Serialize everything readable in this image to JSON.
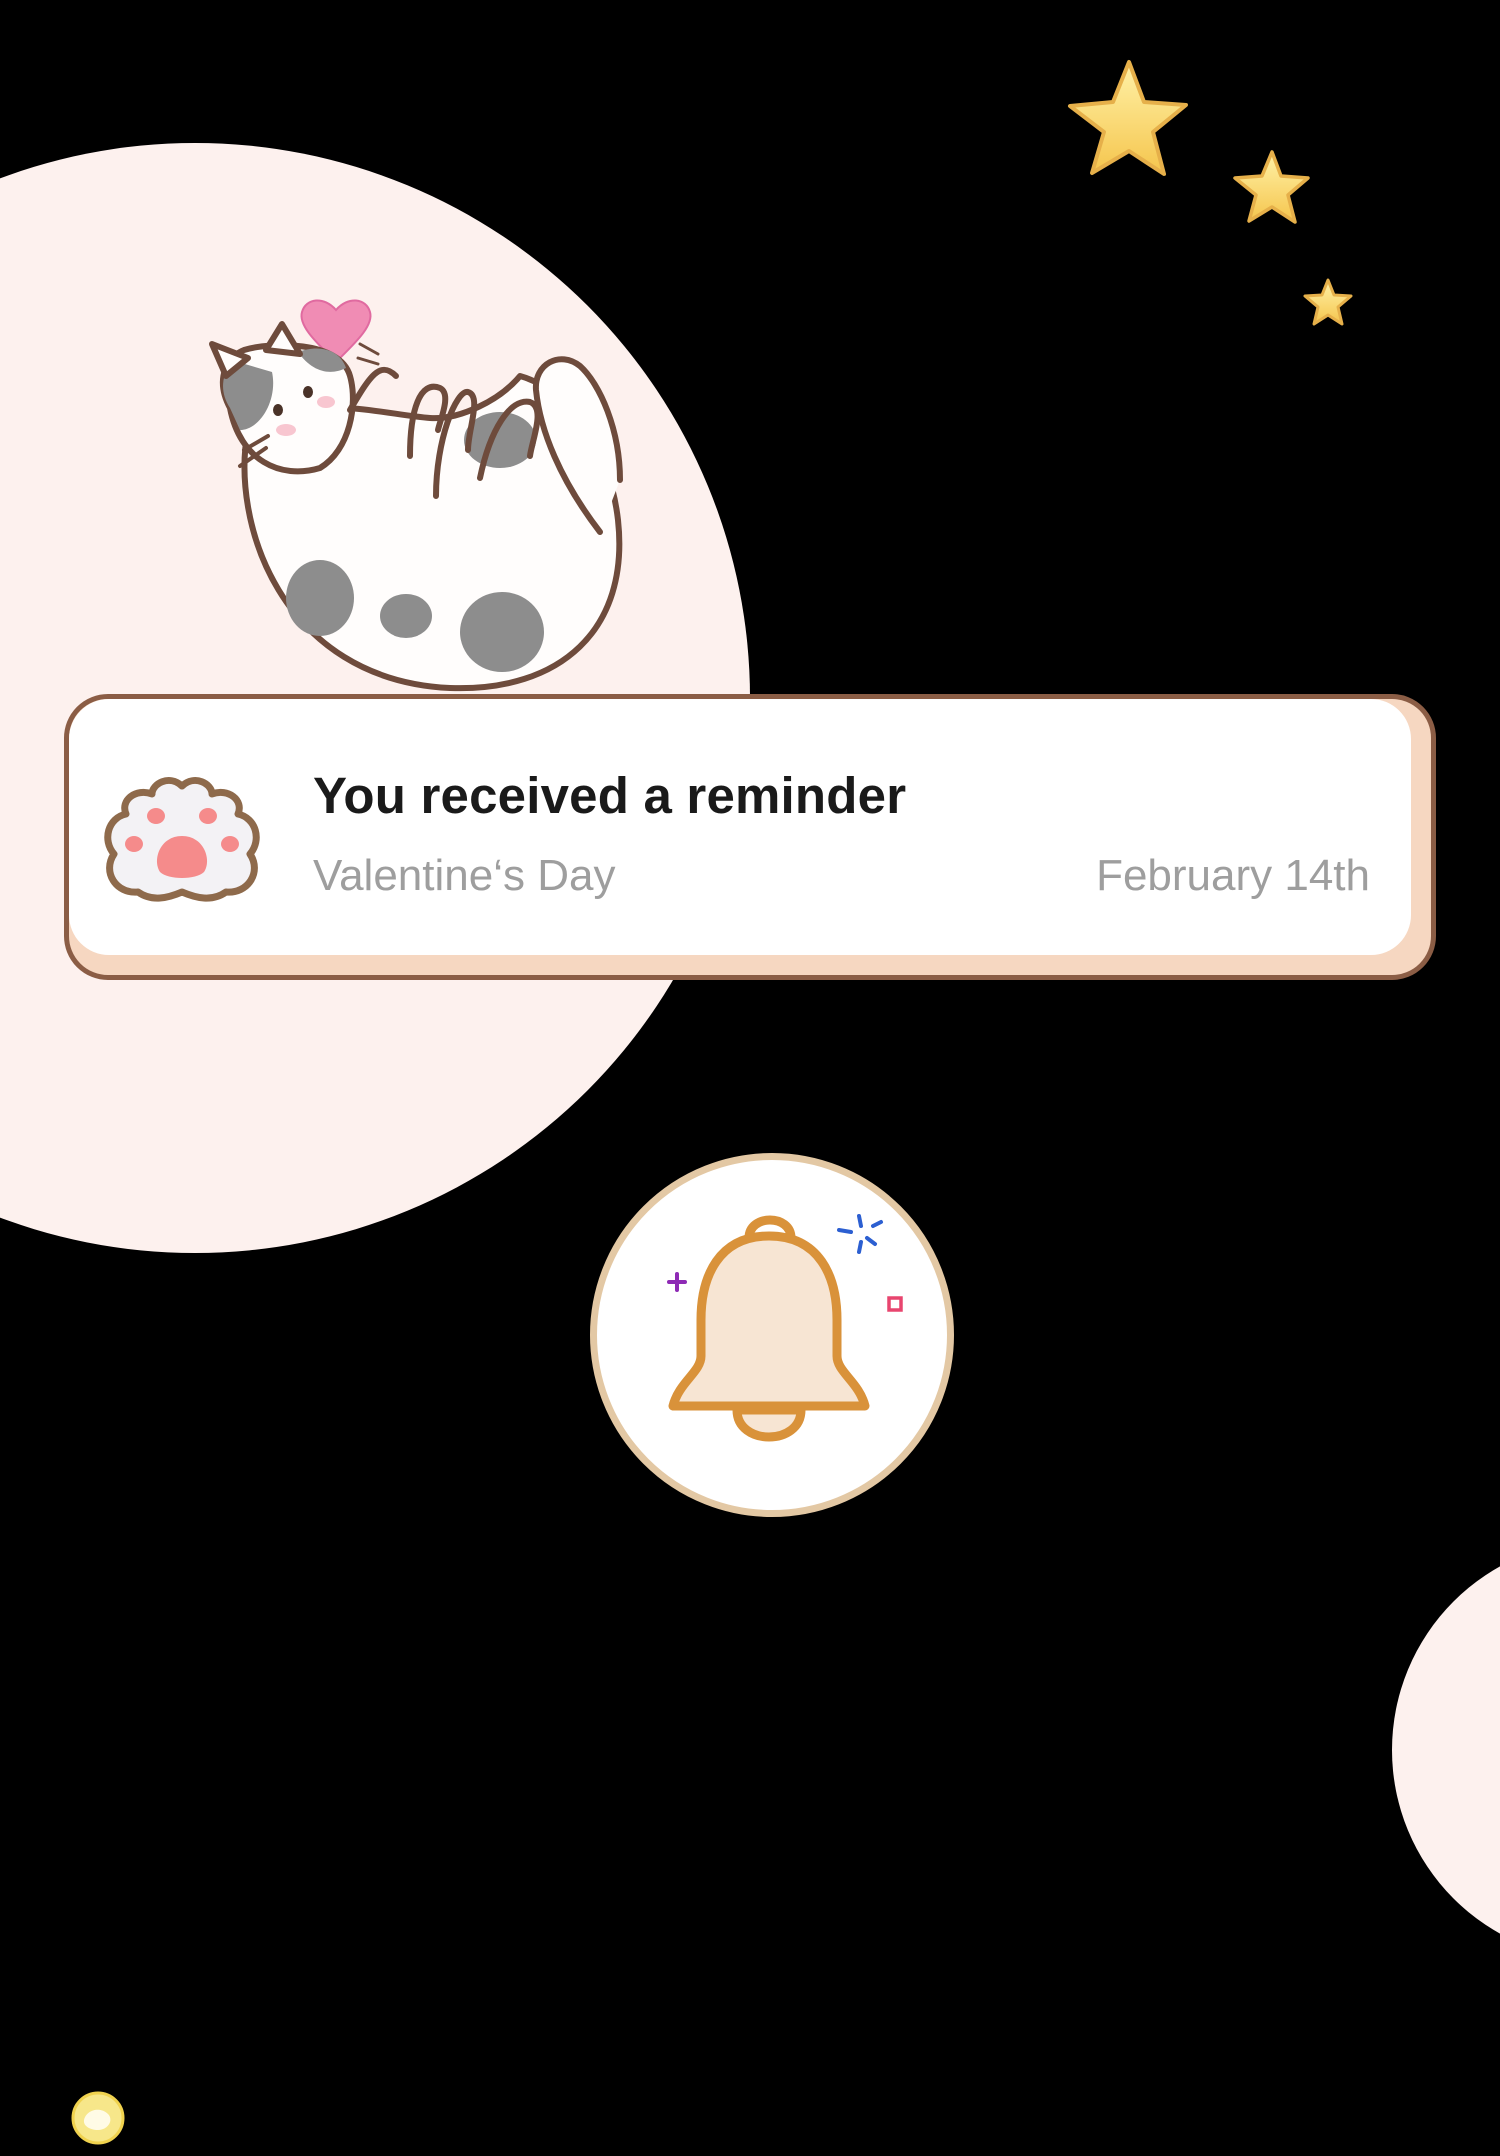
{
  "notification": {
    "title": "You received a reminder",
    "subtitle": "Valentine‘s Day",
    "date": "February 14th",
    "icon": "paw-icon"
  },
  "bell": {
    "icon": "bell-icon"
  },
  "colors": {
    "background": "#000000",
    "blob": "#fdf1ee",
    "card_border": "#8b5d45",
    "card_shadow": "#f6d7c1",
    "bell_stroke": "#d9923a",
    "bell_fill": "#f7e5d3",
    "star": "#f9d468",
    "heart": "#f08cb4"
  }
}
